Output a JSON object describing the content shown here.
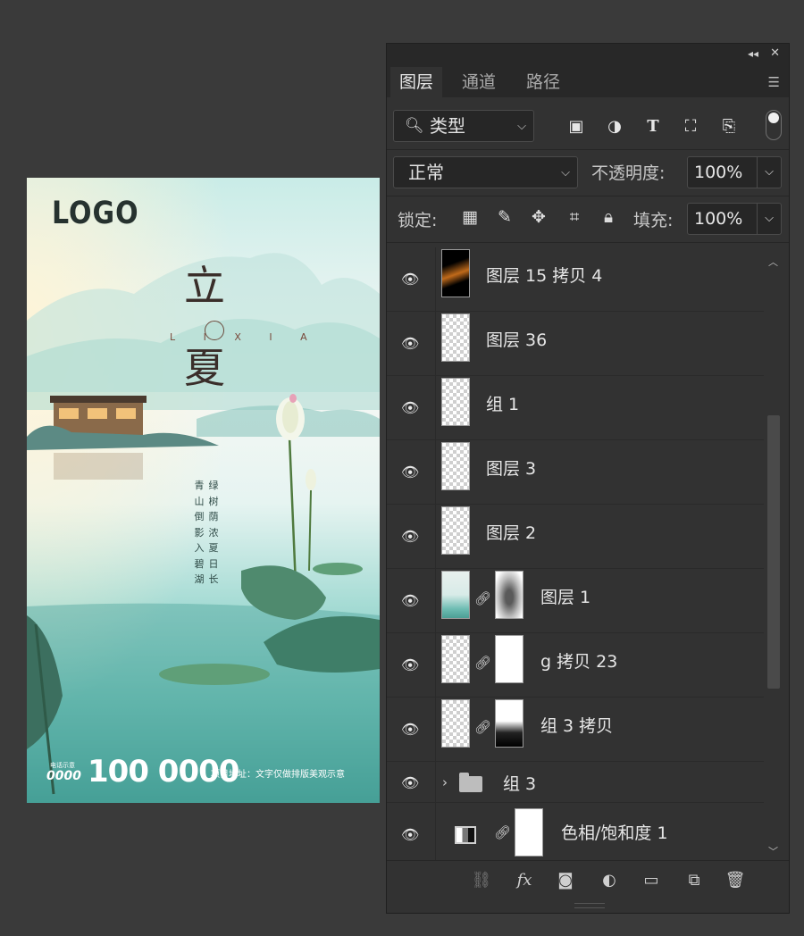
{
  "poster": {
    "logo": "LOGO",
    "title_top": "立",
    "title_bottom": "夏",
    "pinyin": "L I X I A",
    "poem_col1": "青山倒影入碧湖",
    "poem_col2": "绿树荫浓夏日长",
    "phone_label": "电话示意",
    "phone_small": "0000",
    "phone_big": "100 0000",
    "address": "项目地址：文字仅做排版美观示意"
  },
  "panel": {
    "tabs": [
      "图层",
      "通道",
      "路径"
    ],
    "filter_kind": "类型",
    "blend_mode": "正常",
    "opacity_label": "不透明度:",
    "opacity_value": "100%",
    "lock_label": "锁定:",
    "fill_label": "填充:",
    "fill_value": "100%",
    "layers": [
      {
        "name": "图层 15 拷贝 4"
      },
      {
        "name": "图层 36"
      },
      {
        "name": "组 1"
      },
      {
        "name": "图层 3"
      },
      {
        "name": "图层 2"
      },
      {
        "name": "图层 1"
      },
      {
        "name": "g 拷贝 23"
      },
      {
        "name": "组 3 拷贝"
      },
      {
        "name": "组 3"
      },
      {
        "name": "色相/饱和度 1"
      }
    ]
  }
}
